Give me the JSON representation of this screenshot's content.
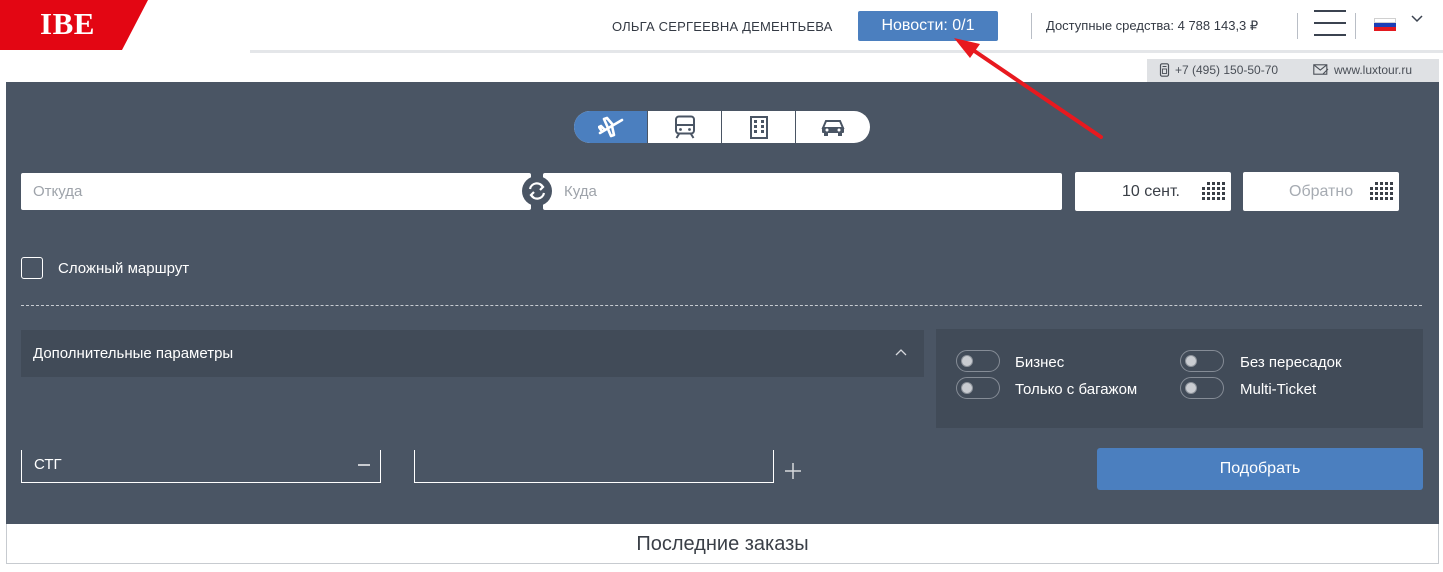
{
  "header": {
    "logo_text": "IBE",
    "user_name": "ОЛЬГА СЕРГЕЕВНА ДЕМЕНТЬЕВА",
    "news_button": "Новости: 0/1",
    "funds": "Доступные средства: 4 788 143,3 ₽",
    "language_icon": "russian-flag-icon"
  },
  "contacts": {
    "phone": "+7 (495) 150-50-70",
    "website": "www.luxtour.ru"
  },
  "search": {
    "modes": [
      "plane-icon",
      "train-icon",
      "hotel-icon",
      "car-icon"
    ],
    "from_placeholder": "Откуда",
    "to_placeholder": "Куда",
    "date_out": "10 сент.",
    "date_return": "Обратно",
    "complex_route_label": "Сложный маршрут",
    "additional_params_label": "Дополнительные параметры",
    "options": [
      {
        "label": "Бизнес",
        "on": false
      },
      {
        "label": "Без пересадок",
        "on": false
      },
      {
        "label": "Только с багажом",
        "on": false
      },
      {
        "label": "Multi-Ticket",
        "on": false
      }
    ],
    "cabin_value": "СТГ",
    "submit_label": "Подобрать"
  },
  "recent_orders": {
    "title": "Последние заказы"
  },
  "colors": {
    "panel": "#4a5564",
    "accent": "#4b7fbf",
    "logo_red": "#e30613",
    "annotation_arrow": "#e8191f"
  }
}
